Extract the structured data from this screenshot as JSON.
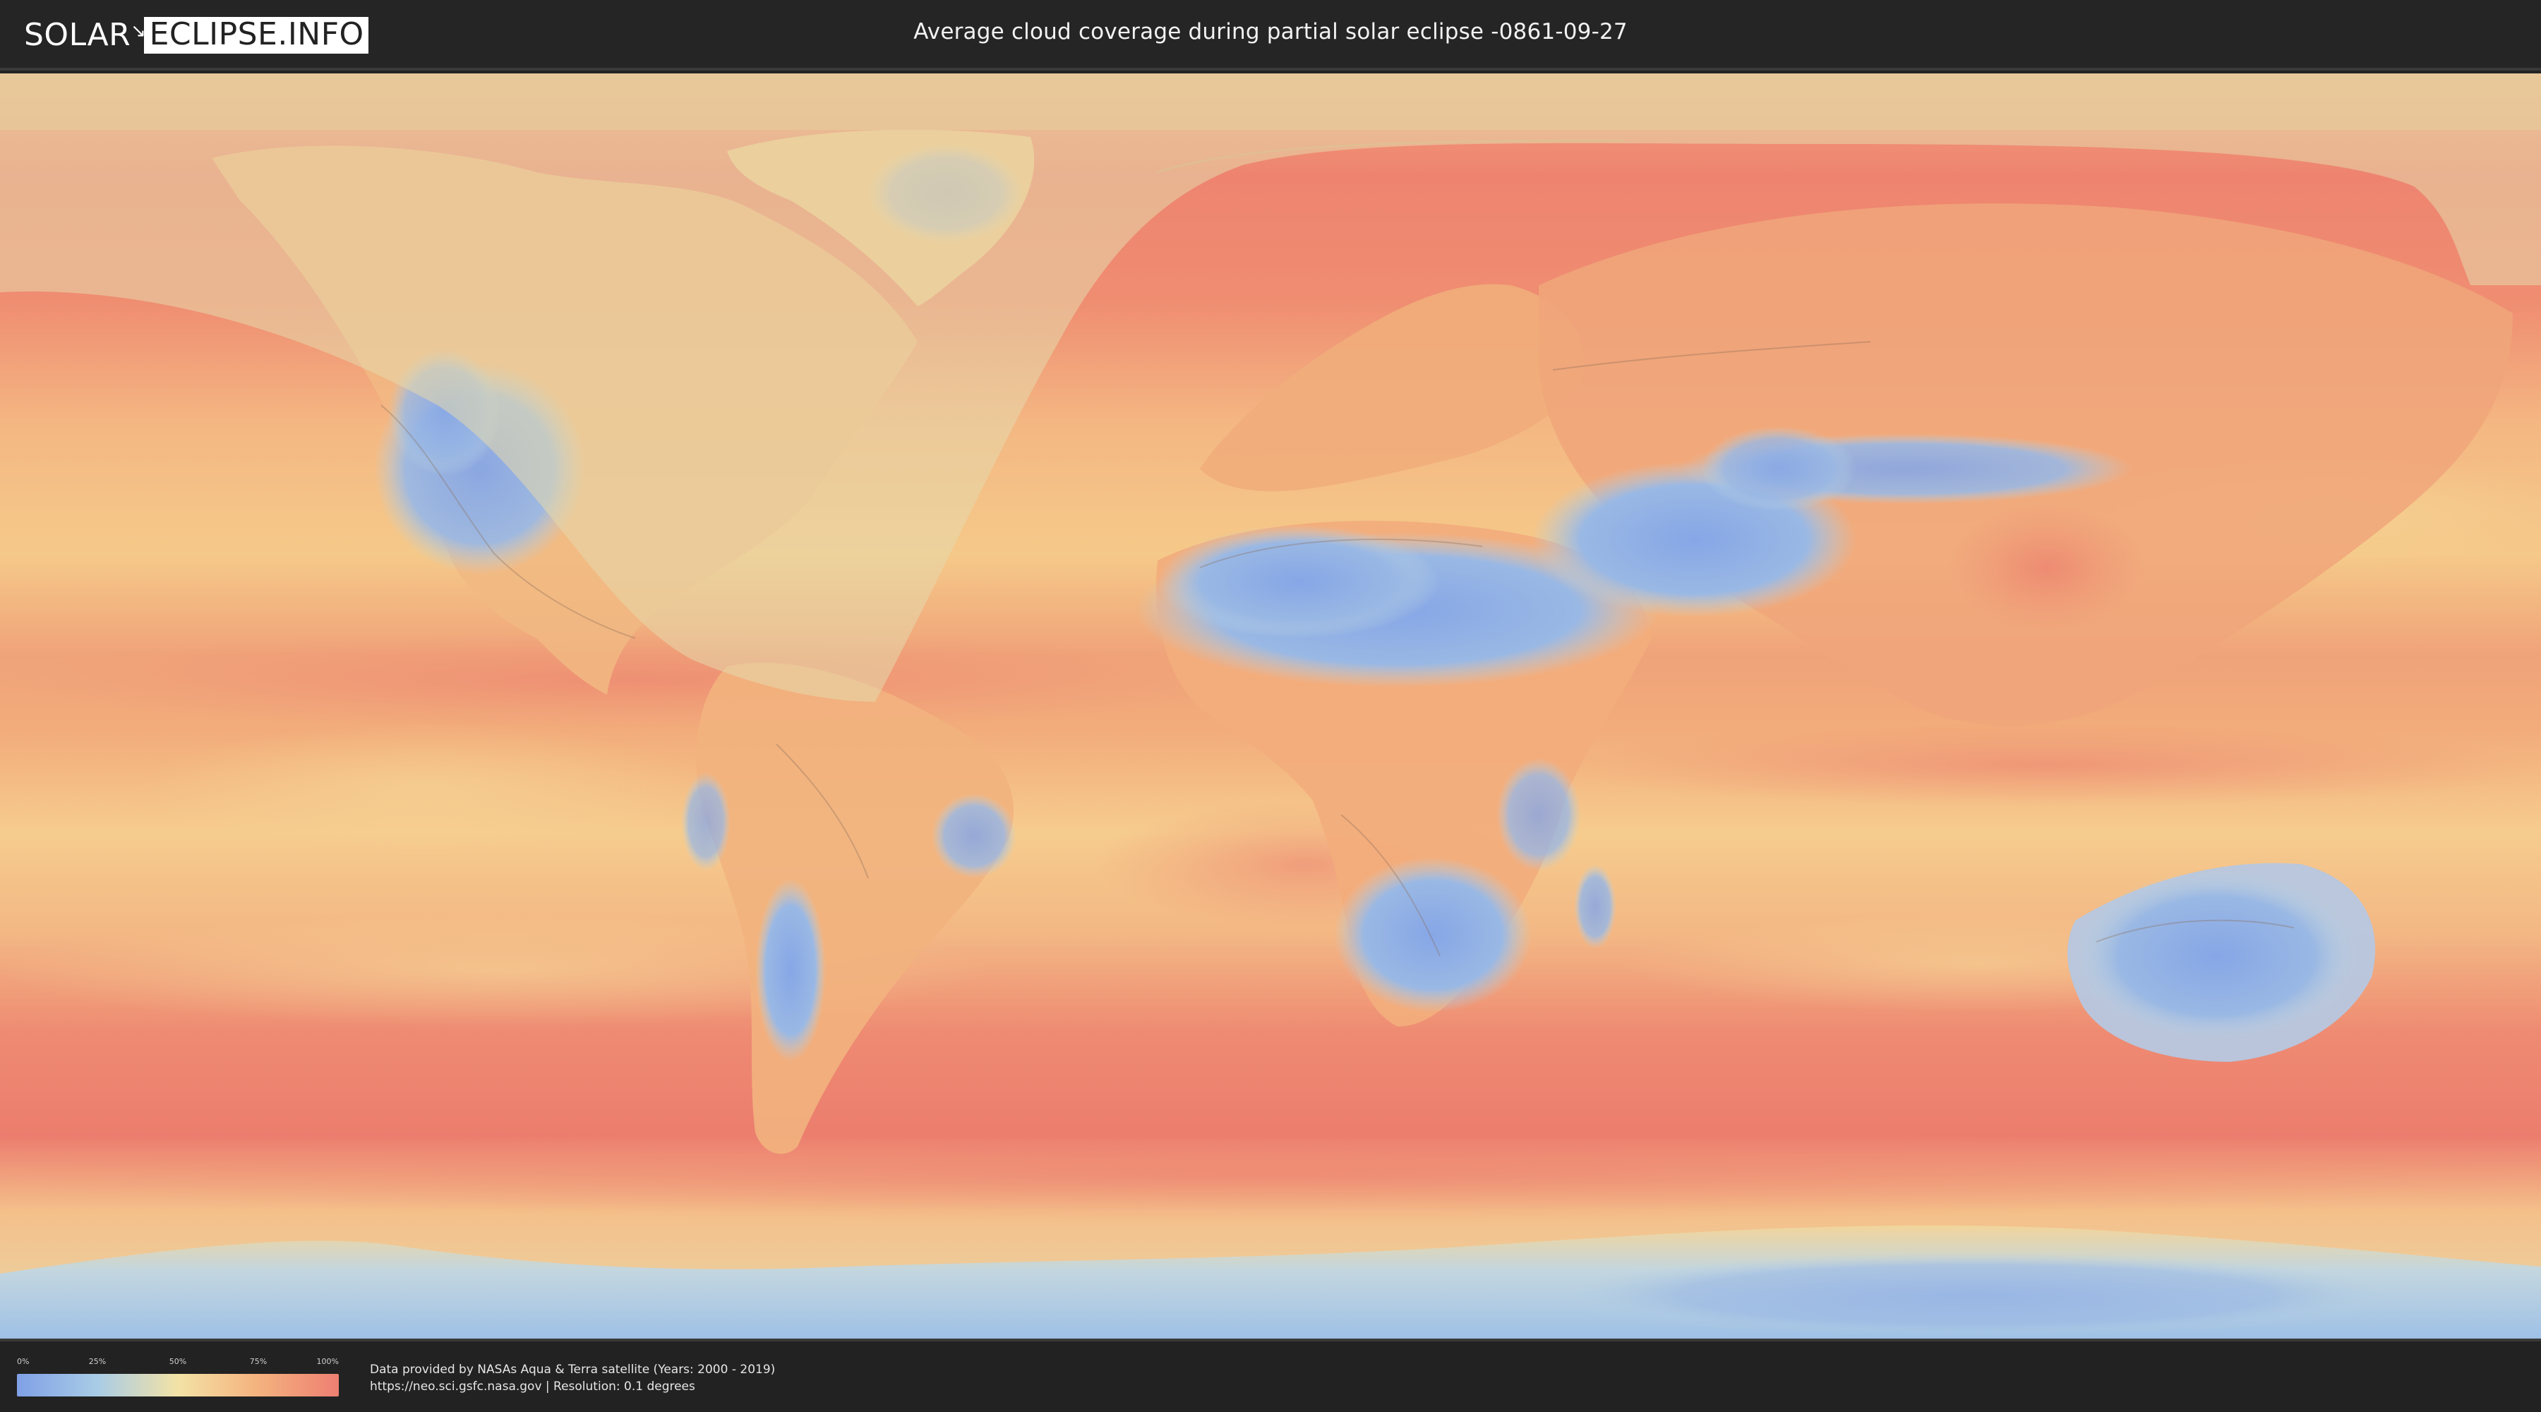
{
  "header": {
    "logo_part_1": "SOLAR",
    "logo_part_2": "ECLIPSE.INFO",
    "title": "Average cloud coverage during partial solar eclipse -0861-09-27"
  },
  "map": {
    "description_icon": "world-cloud-coverage-map",
    "colors": {
      "low_clear": "#8aa9e6",
      "mid_low": "#a9c8e3",
      "mid": "#f0d99a",
      "high": "#f3ad7b",
      "very_high": "#ef8572",
      "eclipse_overlay": "#e3d2a0"
    }
  },
  "legend": {
    "ticks": [
      "0%",
      "25%",
      "50%",
      "75%",
      "100%"
    ],
    "gradient_stops": [
      "#7fa0e6",
      "#a9cce6",
      "#f3e2a6",
      "#f4b27e",
      "#ee7f72"
    ]
  },
  "credits": {
    "line1": "Data provided by NASAs Aqua & Terra satellite (Years: 2000 - 2019)",
    "line2": "https://neo.sci.gsfc.nasa.gov | Resolution: 0.1 degrees"
  }
}
